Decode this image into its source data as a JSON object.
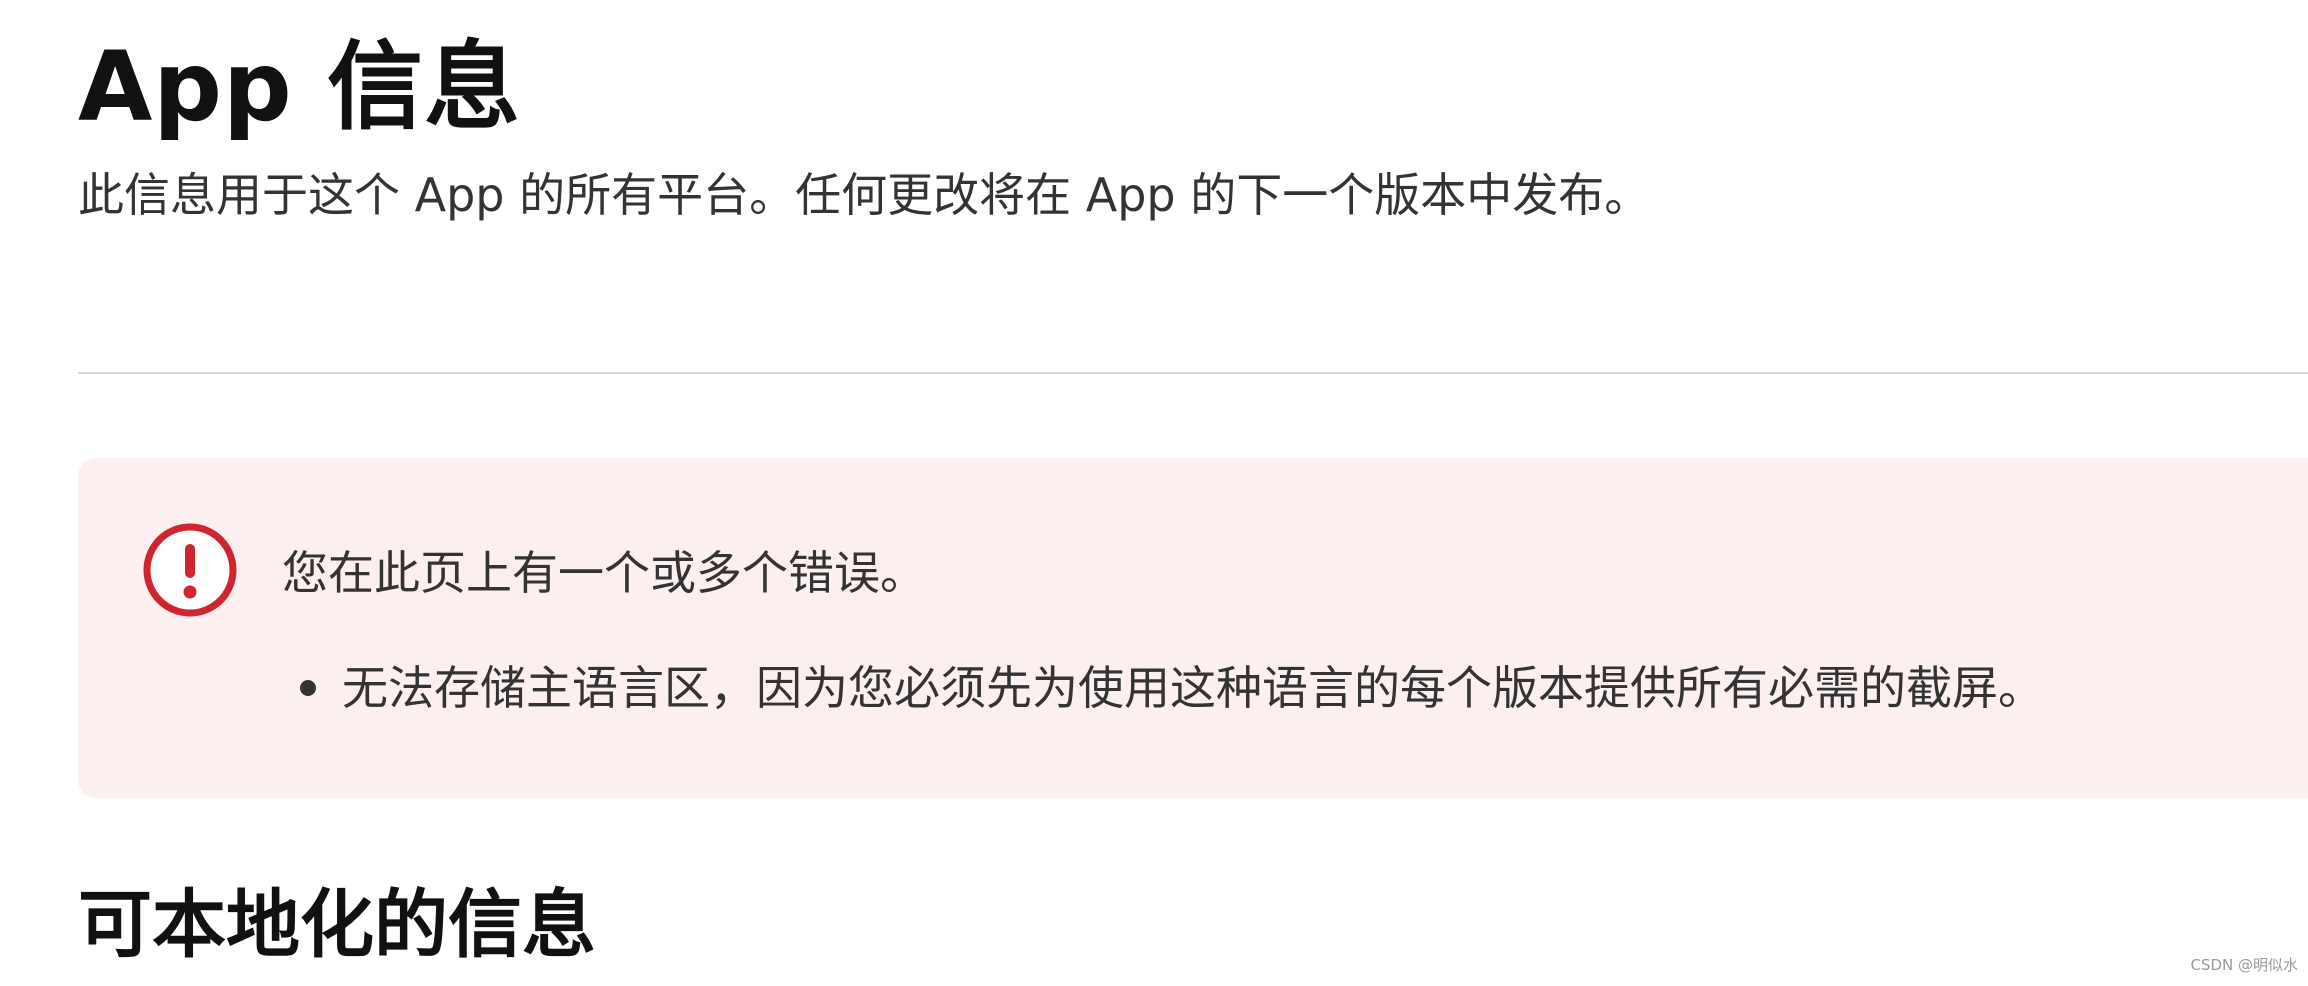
{
  "page": {
    "title": "App 信息",
    "subtitle": "此信息用于这个 App 的所有平台。任何更改将在 App 的下一个版本中发布。"
  },
  "error_panel": {
    "icon": "exclamation-circle-icon",
    "heading": "您在此页上有一个或多个错误。",
    "items": [
      {
        "text": "无法存储主语言区，因为您必须先为使用这种语言的每个版本提供所有必需的截屏。"
      }
    ],
    "colors": {
      "background": "#fbefef",
      "icon": "#d0242f"
    }
  },
  "section": {
    "title": "可本地化的信息"
  },
  "watermark": "CSDN @明似水"
}
